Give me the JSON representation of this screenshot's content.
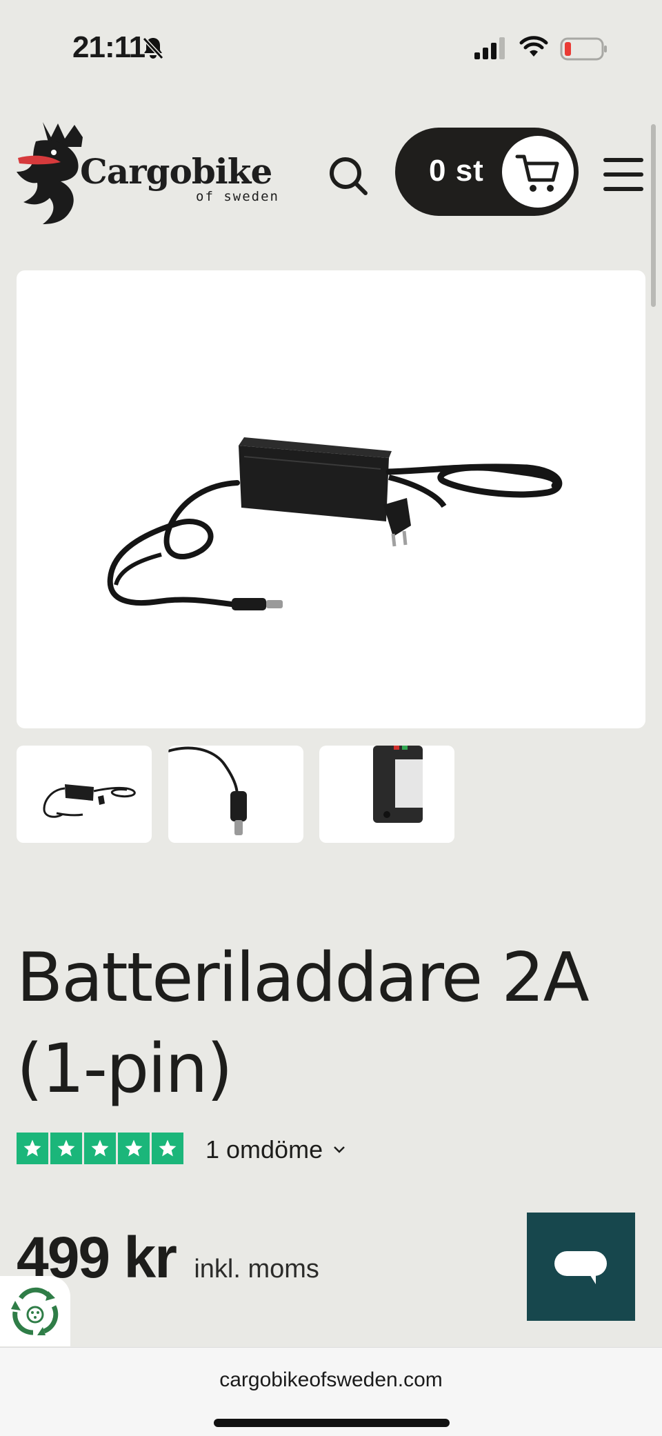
{
  "status_bar": {
    "time": "21:11",
    "icons": [
      "bell-slash-icon",
      "cellular-signal-icon",
      "wifi-icon",
      "battery-low-icon"
    ]
  },
  "header": {
    "logo": {
      "name": "Cargobike",
      "tagline": "of sweden"
    },
    "search_icon": "search-icon",
    "cart": {
      "count_label": "0 st",
      "icon": "cart-icon"
    },
    "menu_icon": "hamburger-menu-icon"
  },
  "gallery": {
    "main_image": "battery-charger-photo",
    "thumbnails": [
      {
        "name": "thumbnail-charger"
      },
      {
        "name": "thumbnail-connector"
      },
      {
        "name": "thumbnail-battery-port"
      }
    ]
  },
  "product": {
    "title": "Batteriladdare 2A (1-pin)",
    "rating": {
      "stars": 5,
      "review_count_label": "1 omdöme",
      "star_color": "#1bb67a"
    },
    "price": "499 kr",
    "price_note": "inkl. moms"
  },
  "browser": {
    "url": "cargobikeofsweden.com"
  },
  "colors": {
    "background": "#e9e9e5",
    "cart_bg": "#1f1e1c",
    "chat_bg": "#17474d",
    "trustpilot_green": "#1bb67a"
  }
}
